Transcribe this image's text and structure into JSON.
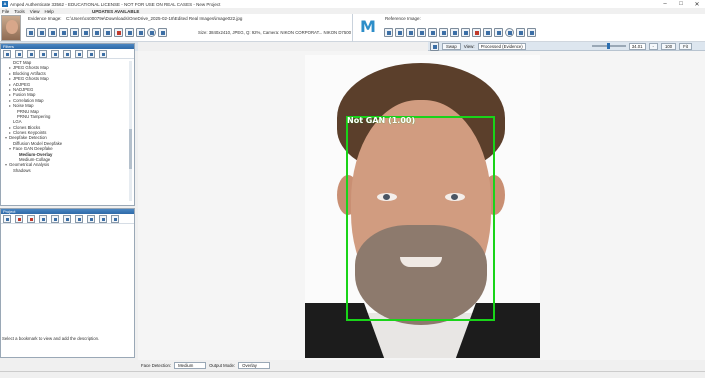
{
  "window": {
    "title": "Amped Authenticate 33562 - EDUCATIONAL LICENSE - NOT FOR USE ON REAL CASES - New Project",
    "updates": "UPDATES AVAILABLE"
  },
  "menu": [
    "File",
    "Tools",
    "View",
    "Help"
  ],
  "evidence": {
    "label": "Evidence Image:",
    "path": "C:\\Users\\cs00079e\\Downloads\\OneDrive_2025-02-18\\Edited Real Images\\image022.jpg",
    "info": "Size: 3840x2410, JPEG, Q: 92%, Camera: NIKON CORPORAT... NIKON D7500"
  },
  "reference": {
    "label": "Reference Image:"
  },
  "right_toolbar": {
    "swap": "Swap",
    "view_label": "View:",
    "view_value": "Processed (Evidence)",
    "zoom": "34.01",
    "minus": "-",
    "hundred": "100",
    "fit": "Fit",
    "zoom_level": 0.48
  },
  "filters_panel": {
    "title": "Filters",
    "items": [
      {
        "label": "DCT Map",
        "twisty": ""
      },
      {
        "label": "JPEG Ghosts Map",
        "twisty": "▸"
      },
      {
        "label": "Blocking Artifacts",
        "twisty": "▸"
      },
      {
        "label": "JPEG Ghosts Map",
        "twisty": "▸"
      },
      {
        "label": "ADJPEG",
        "twisty": "▸"
      },
      {
        "label": "NADJPEG",
        "twisty": "▸"
      },
      {
        "label": "Fusion Map",
        "twisty": "▸"
      },
      {
        "label": "Correlation Map",
        "twisty": "▸"
      },
      {
        "label": "Noise Map",
        "twisty": "▸"
      },
      {
        "label": "PRNU Map",
        "twisty": ""
      },
      {
        "label": "PRNU Tampering",
        "twisty": ""
      },
      {
        "label": "LGA",
        "twisty": ""
      },
      {
        "label": "Clones Blocks",
        "twisty": "▸"
      },
      {
        "label": "Clones Keypoints",
        "twisty": "▸"
      },
      {
        "label": "Deepfake Detection",
        "twisty": "▾"
      },
      {
        "label": "Diffusion Model Deepfake",
        "twisty": ""
      },
      {
        "label": "Face GAN Deepfake",
        "twisty": "▾"
      },
      {
        "label": "Medium-Overlay",
        "twisty": "",
        "bold": true
      },
      {
        "label": "Medium-Collage",
        "twisty": ""
      },
      {
        "label": "Geometrical Analysis",
        "twisty": "▾"
      },
      {
        "label": "Shadows",
        "twisty": ""
      }
    ]
  },
  "project_panel": {
    "title": "Project",
    "description": "Select a bookmark to view and add the description."
  },
  "detection": {
    "label": "Not GAN",
    "score": "(1.00)",
    "color": "#19d419"
  },
  "status_bar": {
    "face_detection_label": "Face Detection:",
    "face_detection_value": "Medium",
    "output_mode_label": "Output Mode:",
    "output_mode_value": "Overlay"
  },
  "colors": {
    "accent": "#2e6aa8",
    "box": "#19d419"
  }
}
